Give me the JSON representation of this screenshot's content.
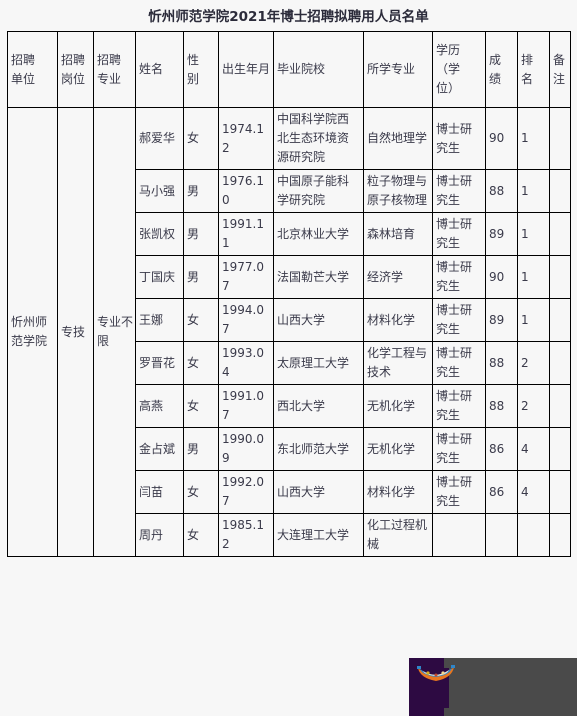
{
  "document": {
    "title": "忻州师范学院2021年博士招聘拟聘用人员名单"
  },
  "table": {
    "headers": {
      "unit": "招聘单位",
      "post": "招聘岗位",
      "major": "招聘专业",
      "name": "姓名",
      "sex": "性别",
      "birth": "出生年月",
      "school": "毕业院校",
      "field": "所学专业",
      "degree_l1": "学历",
      "degree_l2": "（学",
      "degree_l3": "位）",
      "score": "成绩",
      "rank": "排名",
      "note": "备注"
    },
    "merged": {
      "unit": "忻州师范学院",
      "post": "专技",
      "major": "专业不限"
    },
    "rows": [
      {
        "name": "郝爱华",
        "sex": "女",
        "birth": "1974.12",
        "school": "中国科学院西北生态环境资源研究院",
        "field": "自然地理学",
        "degree": "博士研究生",
        "score": "90",
        "rank": "1",
        "note": ""
      },
      {
        "name": "马小强",
        "sex": "男",
        "birth": "1976.10",
        "school": "中国原子能科学研究院",
        "field": "粒子物理与原子核物理",
        "degree": "博士研究生",
        "score": "88",
        "rank": "1",
        "note": ""
      },
      {
        "name": "张凯权",
        "sex": "男",
        "birth": "1991.11",
        "school": "北京林业大学",
        "field": "森林培育",
        "degree": "博士研究生",
        "score": "89",
        "rank": "1",
        "note": ""
      },
      {
        "name": "丁国庆",
        "sex": "男",
        "birth": "1977.07",
        "school": "法国勒芒大学",
        "field": "经济学",
        "degree": "博士研究生",
        "score": "90",
        "rank": "1",
        "note": ""
      },
      {
        "name": "王娜",
        "sex": "女",
        "birth": "1994.07",
        "school": "山西大学",
        "field": "材料化学",
        "degree": "博士研究生",
        "score": "89",
        "rank": "1",
        "note": ""
      },
      {
        "name": "罗晋花",
        "sex": "女",
        "birth": "1993.04",
        "school": "太原理工大学",
        "field": "化学工程与技术",
        "degree": "博士研究生",
        "score": "88",
        "rank": "2",
        "note": ""
      },
      {
        "name": "高燕",
        "sex": "女",
        "birth": "1991.07",
        "school": "西北大学",
        "field": "无机化学",
        "degree": "博士研究生",
        "score": "88",
        "rank": "2",
        "note": ""
      },
      {
        "name": "金占斌",
        "sex": "男",
        "birth": "1990.09",
        "school": "东北师范大学",
        "field": "无机化学",
        "degree": "博士研究生",
        "score": "86",
        "rank": "4",
        "note": ""
      },
      {
        "name": "闫苗",
        "sex": "女",
        "birth": "1992.07",
        "school": "山西大学",
        "field": "材料化学",
        "degree": "博士研究生",
        "score": "86",
        "rank": "4",
        "note": ""
      },
      {
        "name": "周丹",
        "sex": "女",
        "birth": "1985.12",
        "school": "大连理工大学",
        "field": "化工过程机械",
        "degree": "",
        "score": "",
        "rank": "",
        "note": ""
      }
    ]
  },
  "overlay": {
    "purple_color": "#2d0a42",
    "gray_color": "#4a4a4a",
    "sprite_name": "boat-sprite"
  }
}
